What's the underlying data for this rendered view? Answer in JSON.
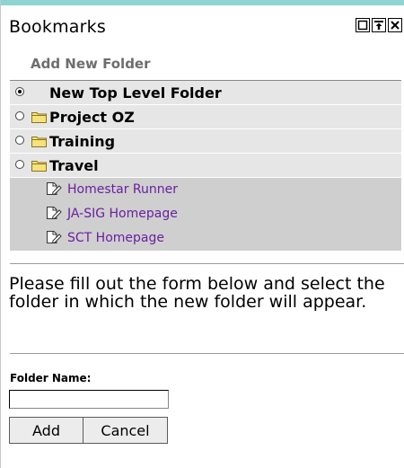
{
  "portlet": {
    "title": "Bookmarks",
    "controls": [
      {
        "icon": "minimize-icon"
      },
      {
        "icon": "maximize-icon"
      },
      {
        "icon": "close-icon"
      }
    ],
    "accent_color": "#8fd3d3"
  },
  "subtitle": "Add New Folder",
  "tree": {
    "top_level": {
      "label": "New Top Level Folder",
      "selected": true
    },
    "folders": [
      {
        "label": "Project OZ",
        "selected": false,
        "icon": "folder-icon"
      },
      {
        "label": "Training",
        "selected": false,
        "icon": "folder-icon"
      },
      {
        "label": "Travel",
        "selected": false,
        "icon": "folder-icon"
      }
    ],
    "bookmarks": [
      {
        "label": "Homestar Runner",
        "icon": "bookmark-icon"
      },
      {
        "label": "JA-SIG Homepage",
        "icon": "bookmark-icon"
      },
      {
        "label": "SCT Homepage",
        "icon": "bookmark-icon"
      }
    ],
    "link_color": "#6a1fa0"
  },
  "instructions": "Please fill out the form below and select the folder in which the new folder will appear.",
  "form": {
    "field_label": "Folder Name:",
    "field_value": "",
    "add_label": "Add",
    "cancel_label": "Cancel"
  }
}
